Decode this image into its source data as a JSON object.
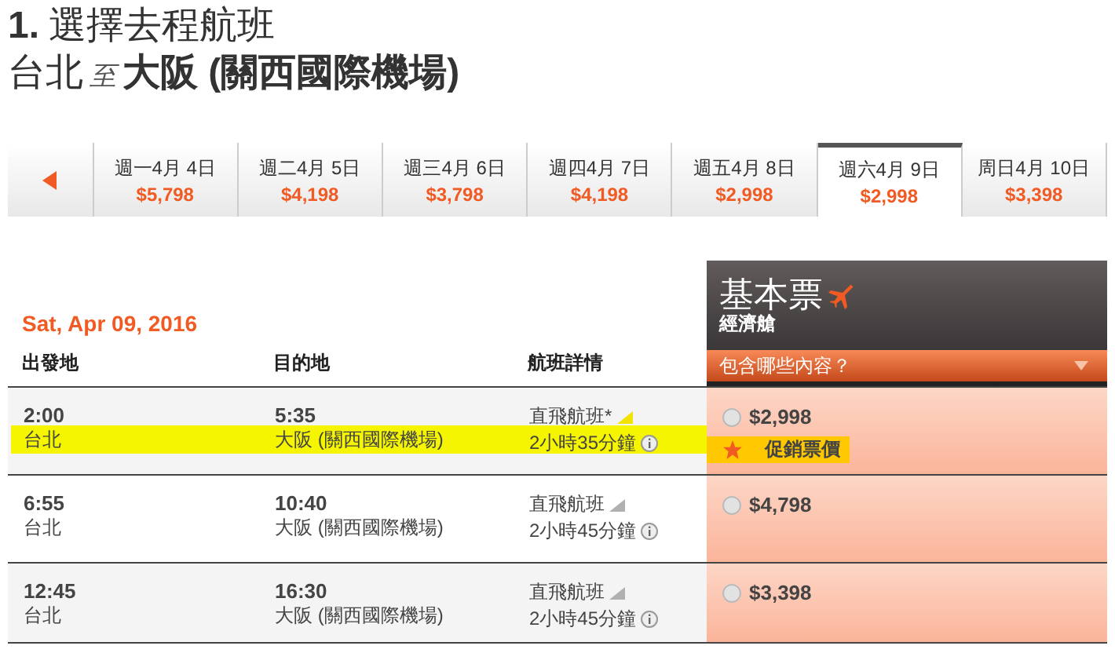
{
  "heading": {
    "step": "1.",
    "title": "選擇去程航班",
    "origin": "台北",
    "connector": "至",
    "destination": "大阪 (關西國際機場)"
  },
  "date_tabs": [
    {
      "label": "週一4月 4日",
      "price": "$5,798",
      "selected": false
    },
    {
      "label": "週二4月 5日",
      "price": "$4,198",
      "selected": false
    },
    {
      "label": "週三4月 6日",
      "price": "$3,798",
      "selected": false
    },
    {
      "label": "週四4月 7日",
      "price": "$4,198",
      "selected": false
    },
    {
      "label": "週五4月 8日",
      "price": "$2,998",
      "selected": false
    },
    {
      "label": "週六4月 9日",
      "price": "$2,998",
      "selected": true
    },
    {
      "label": "周日4月 10日",
      "price": "$3,398",
      "selected": false
    }
  ],
  "date": "Sat, Apr 09, 2016",
  "columns": [
    "出發地",
    "目的地",
    "航班詳情"
  ],
  "fare": {
    "name": "基本票",
    "cabin": "經濟艙",
    "includes": "包含哪些內容？"
  },
  "flights": [
    {
      "departure": "2:00",
      "origin": "台北",
      "arrival": "5:35",
      "destination": "大阪 (關西國際機場)",
      "type": "直飛航班*",
      "duration": "2小時35分鐘",
      "price": "$2,998",
      "selected": false,
      "promo": "促銷票價",
      "highlighted": true
    },
    {
      "departure": "6:55",
      "origin": "台北",
      "arrival": "10:40",
      "destination": "大阪 (關西國際機場)",
      "type": "直飛航班",
      "duration": "2小時45分鐘",
      "price": "$4,798",
      "selected": false,
      "highlighted": false
    },
    {
      "departure": "12:45",
      "origin": "台北",
      "arrival": "16:30",
      "destination": "大阪 (關西國際機場)",
      "type": "直飛航班",
      "duration": "2小時45分鐘",
      "price": "$3,398",
      "selected": false,
      "highlighted": false
    }
  ]
}
